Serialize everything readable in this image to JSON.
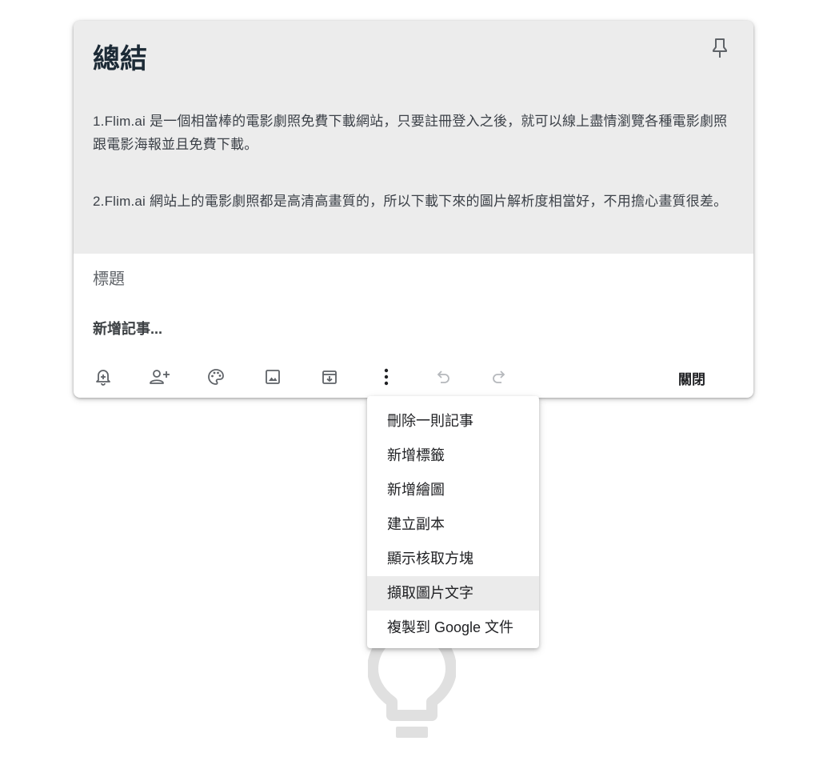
{
  "note": {
    "image": {
      "title": "總結",
      "paragraphs": [
        "1.Flim.ai 是一個相當棒的電影劇照免費下載網站，只要註冊登入之後，就可以線上盡情瀏覽各種電影劇照跟電影海報並且免費下載。",
        "2.Flim.ai 網站上的電影劇照都是高清高畫質的，所以下載下來的圖片解析度相當好，不用擔心畫質很差。"
      ]
    },
    "title_placeholder": "標題",
    "body_placeholder": "新增記事...",
    "toolbar": {
      "icons": [
        "reminder-icon",
        "collaborator-icon",
        "palette-icon",
        "image-icon",
        "archive-icon",
        "more-icon",
        "undo-icon",
        "redo-icon"
      ],
      "close_label": "關閉"
    }
  },
  "more_menu": {
    "items": [
      {
        "label": "刪除一則記事",
        "highlighted": false
      },
      {
        "label": "新增標籤",
        "highlighted": false
      },
      {
        "label": "新增繪圖",
        "highlighted": false
      },
      {
        "label": "建立副本",
        "highlighted": false
      },
      {
        "label": "顯示核取方塊",
        "highlighted": false
      },
      {
        "label": "擷取圖片文字",
        "highlighted": true
      },
      {
        "label": "複製到 Google 文件",
        "highlighted": false
      }
    ]
  },
  "colors": {
    "image_background": "#ececec",
    "menu_highlight": "#ebebeb",
    "icon": "#5f6368",
    "icon_disabled": "#b5b8bc",
    "bulb": "#e0e0e0"
  }
}
